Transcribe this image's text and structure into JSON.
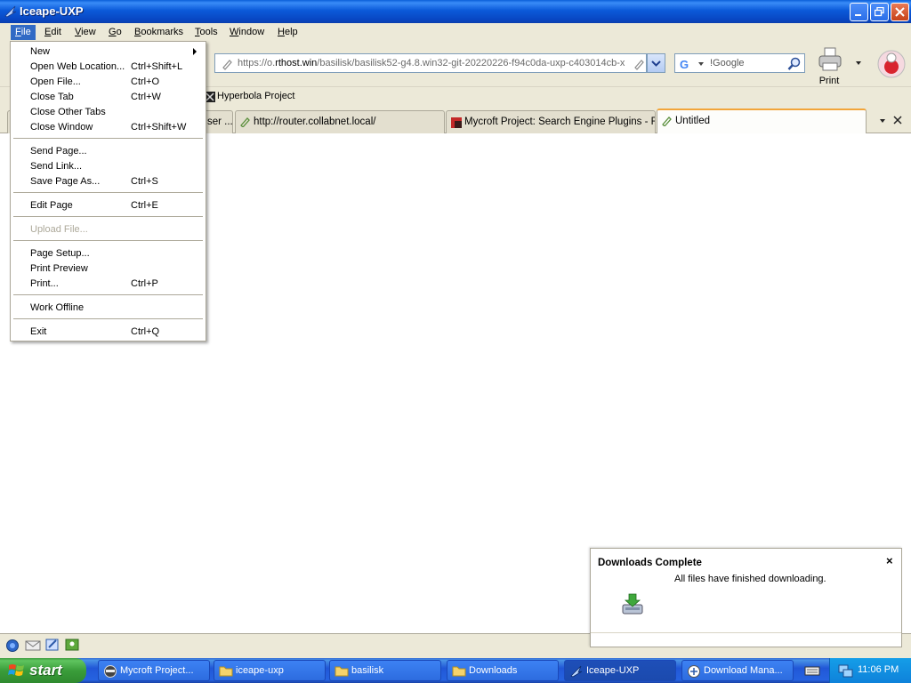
{
  "window": {
    "title": "Iceape-UXP"
  },
  "menubar": [
    {
      "label": "File",
      "key": "F",
      "rest": "ile"
    },
    {
      "label": "Edit",
      "key": "E",
      "rest": "dit"
    },
    {
      "label": "View",
      "key": "V",
      "rest": "iew"
    },
    {
      "label": "Go",
      "key": "G",
      "rest": "o"
    },
    {
      "label": "Bookmarks",
      "key": "B",
      "rest": "ookmarks"
    },
    {
      "label": "Tools",
      "key": "T",
      "rest": "ools"
    },
    {
      "label": "Window",
      "key": "W",
      "rest": "indow"
    },
    {
      "label": "Help",
      "key": "H",
      "rest": "elp"
    }
  ],
  "file_menu": {
    "items": [
      {
        "label": "New",
        "shortcut": ""
      },
      {
        "label": "Open Web Location...",
        "shortcut": "Ctrl+Shift+L"
      },
      {
        "label": "Open File...",
        "shortcut": "Ctrl+O"
      },
      {
        "label": "Close Tab",
        "shortcut": "Ctrl+W"
      },
      {
        "label": "Close Other Tabs",
        "shortcut": ""
      },
      {
        "label": "Close Window",
        "shortcut": "Ctrl+Shift+W"
      },
      {
        "label": "Send Page...",
        "shortcut": ""
      },
      {
        "label": "Send Link...",
        "shortcut": ""
      },
      {
        "label": "Save Page As...",
        "shortcut": "Ctrl+S"
      },
      {
        "label": "Edit Page",
        "shortcut": "Ctrl+E"
      },
      {
        "label": "Upload File...",
        "shortcut": ""
      },
      {
        "label": "Page Setup...",
        "shortcut": ""
      },
      {
        "label": "Print Preview",
        "shortcut": ""
      },
      {
        "label": "Print...",
        "shortcut": "Ctrl+P"
      },
      {
        "label": "Work Offline",
        "shortcut": ""
      },
      {
        "label": "Exit",
        "shortcut": "Ctrl+Q"
      }
    ]
  },
  "toolbar": {
    "url_prefix": "https://o.",
    "url_host": "rthost.win",
    "url_rest": "/basilisk/basilisk52-g4.8.win32-git-20220226-f94c0da-uxp-c403014cb-x",
    "search_placeholder": "!Google",
    "print_label": "Print"
  },
  "bookmarks": [
    {
      "label": "Hyperbola Project"
    }
  ],
  "tabs": [
    {
      "label": "ser ..."
    },
    {
      "label": "http://router.collabnet.local/"
    },
    {
      "label": "Mycroft Project: Search Engine Plugins - F..."
    },
    {
      "label": "Untitled"
    }
  ],
  "notification": {
    "title": "Downloads Complete",
    "message": "All files have finished downloading."
  },
  "taskbar": {
    "start_label": "start",
    "tasks": [
      {
        "label": "Mycroft Project..."
      },
      {
        "label": "iceape-uxp"
      },
      {
        "label": "basilisk"
      },
      {
        "label": "Downloads"
      },
      {
        "label": "Iceape-UXP"
      },
      {
        "label": "Download Mana..."
      }
    ],
    "clock": "11:06 PM"
  },
  "colors": {
    "accent": "#316ac5",
    "titlebar": "#0b5ad9",
    "taskbar": "#2157d7",
    "start": "#3a9d3a",
    "tab_highlight": "#f2a53a"
  }
}
